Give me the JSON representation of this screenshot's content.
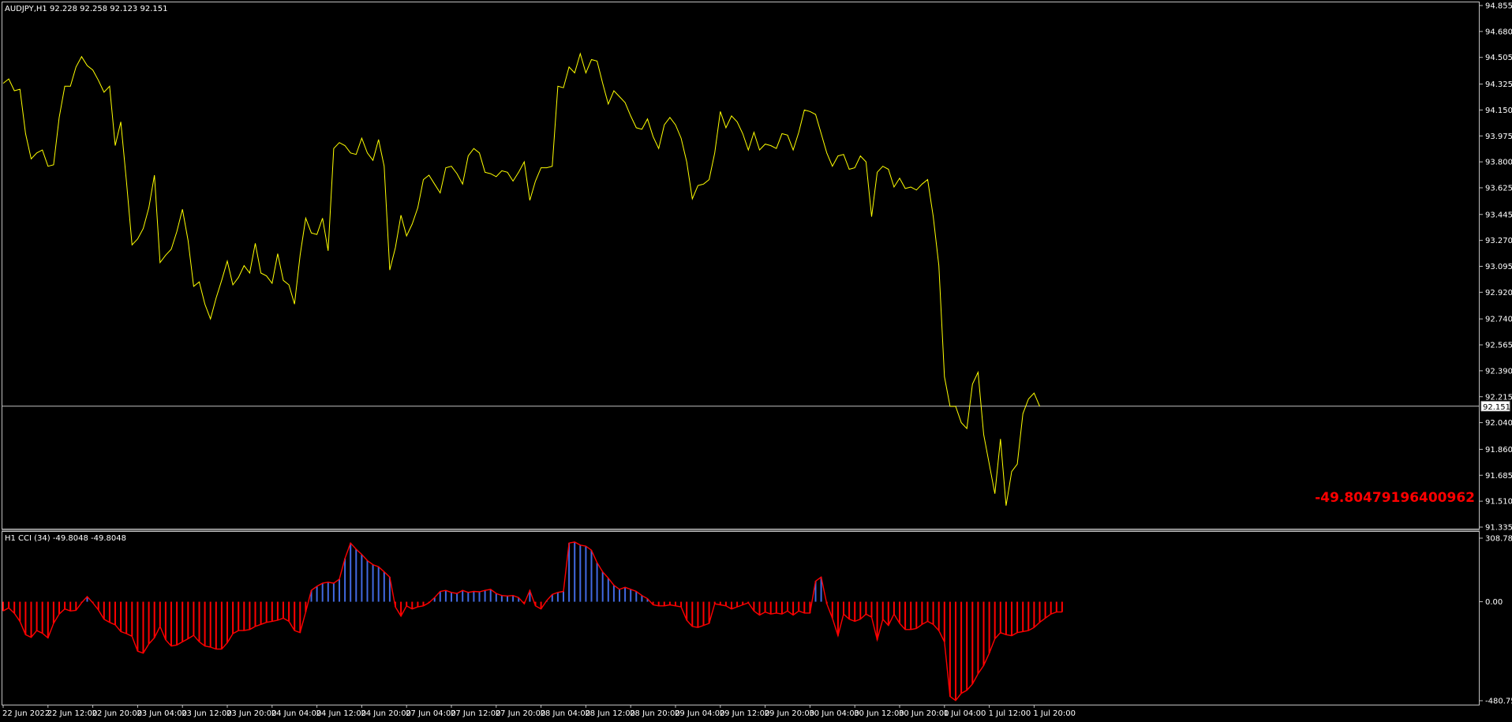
{
  "main_header": "AUDJPY,H1  92.228 92.258 92.123 92.151",
  "cci_header": "H1 CCI (34) -49.8048 -49.8048",
  "cci_value_text": "-49.80479196400962",
  "current_price_label": "92.151",
  "colors": {
    "background": "#000000",
    "frame": "#c0c0c0",
    "price_line": "#ffff00",
    "cci_positive": "#4169e1",
    "cci_negative": "#ff0000",
    "cci_value_text": "#ff0000",
    "current_price_line": "#c0c0c0"
  },
  "x_tick_labels": [
    "22 Jun 2022",
    "22 Jun 12:00",
    "22 Jun 20:00",
    "23 Jun 04:00",
    "23 Jun 12:00",
    "23 Jun 20:00",
    "24 Jun 04:00",
    "24 Jun 12:00",
    "24 Jun 20:00",
    "27 Jun 04:00",
    "27 Jun 12:00",
    "27 Jun 20:00",
    "28 Jun 04:00",
    "28 Jun 12:00",
    "28 Jun 20:00",
    "29 Jun 04:00",
    "29 Jun 12:00",
    "29 Jun 20:00",
    "30 Jun 04:00",
    "30 Jun 12:00",
    "30 Jun 20:00",
    "1 Jul 04:00",
    "1 Jul 12:00",
    "1 Jul 20:00"
  ],
  "chart_data": [
    {
      "type": "line",
      "title": "AUDJPY,H1",
      "y_tick_labels": [
        "94.855",
        "94.680",
        "94.505",
        "94.325",
        "94.150",
        "93.975",
        "93.800",
        "93.625",
        "93.445",
        "93.270",
        "93.095",
        "92.920",
        "92.740",
        "92.565",
        "92.390",
        "92.215",
        "92.040",
        "91.860",
        "91.685",
        "91.510",
        "91.335"
      ],
      "ylim": [
        91.335,
        94.855
      ],
      "current_price": 92.151,
      "series": [
        {
          "values": [
            94.33,
            94.36,
            94.28,
            94.29,
            93.99,
            93.82,
            93.86,
            93.88,
            93.77,
            93.78,
            94.1,
            94.31,
            94.31,
            94.44,
            94.51,
            94.45,
            94.42,
            94.35,
            94.27,
            94.31,
            93.91,
            94.07,
            93.67,
            93.24,
            93.28,
            93.35,
            93.49,
            93.71,
            93.12,
            93.17,
            93.21,
            93.33,
            93.48,
            93.27,
            92.96,
            92.99,
            92.84,
            92.74,
            92.88,
            93.0,
            93.13,
            92.97,
            93.02,
            93.1,
            93.05,
            93.25,
            93.05,
            93.03,
            92.98,
            93.18,
            93.0,
            92.97,
            92.84,
            93.17,
            93.42,
            93.32,
            93.31,
            93.42,
            93.2,
            93.89,
            93.93,
            93.91,
            93.86,
            93.85,
            93.96,
            93.86,
            93.81,
            93.95,
            93.77,
            93.07,
            93.22,
            93.44,
            93.3,
            93.38,
            93.49,
            93.68,
            93.71,
            93.65,
            93.59,
            93.76,
            93.77,
            93.72,
            93.65,
            93.84,
            93.89,
            93.86,
            93.73,
            93.72,
            93.7,
            93.74,
            93.73,
            93.67,
            93.73,
            93.8,
            93.54,
            93.67,
            93.76,
            93.76,
            93.77,
            94.31,
            94.3,
            94.44,
            94.4,
            94.53,
            94.4,
            94.49,
            94.48,
            94.33,
            94.19,
            94.28,
            94.24,
            94.2,
            94.11,
            94.03,
            94.02,
            94.09,
            93.97,
            93.89,
            94.05,
            94.1,
            94.05,
            93.96,
            93.8,
            93.55,
            93.64,
            93.65,
            93.68,
            93.86,
            94.14,
            94.03,
            94.11,
            94.07,
            93.99,
            93.88,
            94.0,
            93.88,
            93.92,
            93.91,
            93.89,
            93.99,
            93.98,
            93.88,
            94.0,
            94.15,
            94.14,
            94.12,
            93.99,
            93.86,
            93.77,
            93.84,
            93.85,
            93.75,
            93.76,
            93.84,
            93.8,
            93.43,
            93.73,
            93.77,
            93.75,
            93.63,
            93.69,
            93.62,
            93.63,
            93.61,
            93.65,
            93.68,
            93.43,
            93.1,
            92.35,
            92.15,
            92.15,
            92.04,
            92.0,
            92.3,
            92.38,
            91.96,
            91.76,
            91.56,
            91.93,
            91.48,
            91.71,
            91.76,
            92.1,
            92.2,
            92.24,
            92.15
          ]
        }
      ]
    },
    {
      "type": "bar",
      "title": "H1 CCI (34)",
      "y_tick_labels": [
        "308.7895",
        "0.00",
        "-480.752"
      ],
      "ylim": [
        -480.752,
        308.7895
      ],
      "series": [
        {
          "values": [
            -45,
            -30,
            -56,
            -96,
            -160,
            -173,
            -140,
            -153,
            -176,
            -105,
            -60,
            -35,
            -45,
            -42,
            -5,
            25,
            -5,
            -40,
            -85,
            -100,
            -112,
            -145,
            -155,
            -168,
            -240,
            -250,
            -205,
            -175,
            -120,
            -185,
            -215,
            -210,
            -195,
            -180,
            -163,
            -195,
            -215,
            -220,
            -230,
            -230,
            -200,
            -155,
            -140,
            -140,
            -135,
            -120,
            -110,
            -100,
            -95,
            -90,
            -80,
            -95,
            -140,
            -150,
            -50,
            55,
            75,
            90,
            95,
            90,
            110,
            210,
            285,
            255,
            230,
            200,
            180,
            170,
            145,
            120,
            -25,
            -70,
            -20,
            -35,
            -25,
            -20,
            -5,
            20,
            50,
            55,
            45,
            40,
            55,
            45,
            50,
            48,
            55,
            60,
            40,
            30,
            28,
            30,
            20,
            -10,
            55,
            -20,
            -35,
            5,
            35,
            45,
            50,
            285,
            290,
            275,
            270,
            250,
            190,
            145,
            115,
            80,
            60,
            70,
            60,
            50,
            30,
            15,
            -15,
            -20,
            -20,
            -15,
            -20,
            -25,
            -90,
            -120,
            -125,
            -115,
            -105,
            -10,
            -15,
            -20,
            -35,
            -25,
            -15,
            -5,
            -45,
            -65,
            -50,
            -60,
            -55,
            -60,
            -45,
            -65,
            -45,
            -55,
            -55,
            100,
            120,
            -10,
            -80,
            -165,
            -60,
            -85,
            -95,
            -85,
            -60,
            -75,
            -185,
            -85,
            -115,
            -60,
            -105,
            -135,
            -135,
            -130,
            -110,
            -95,
            -110,
            -140,
            -195,
            -460,
            -480,
            -445,
            -430,
            -400,
            -350,
            -310,
            -250,
            -180,
            -150,
            -160,
            -165,
            -150,
            -145,
            -140,
            -125,
            -100,
            -80,
            -60,
            -50,
            -50
          ]
        }
      ]
    }
  ]
}
